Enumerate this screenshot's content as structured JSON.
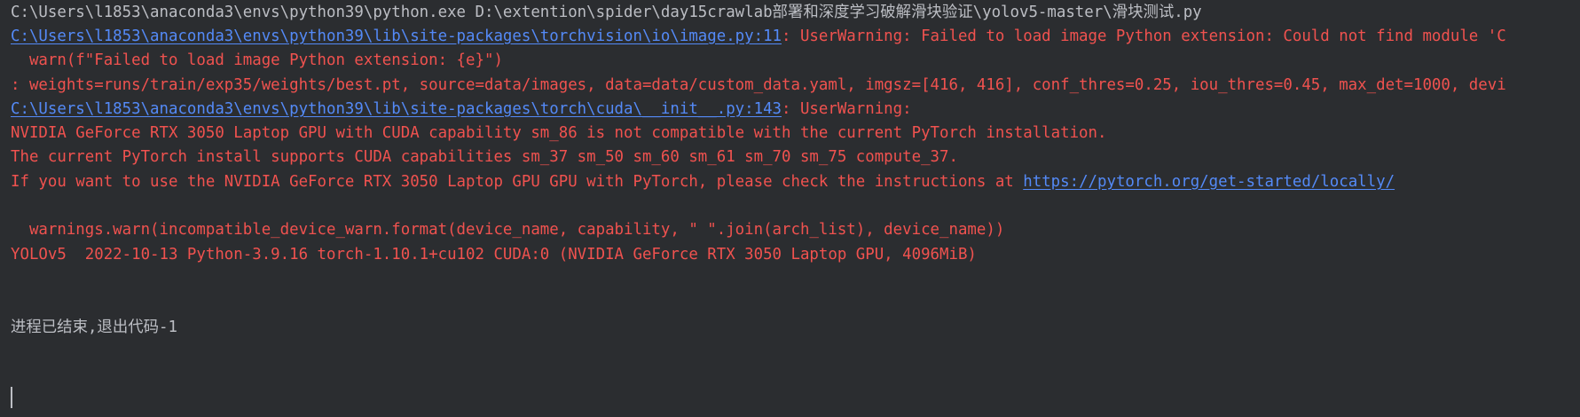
{
  "console": {
    "cmd_line": "C:\\Users\\l1853\\anaconda3\\envs\\python39\\python.exe D:\\extention\\spider\\day15crawlab部署和深度学习破解滑块验证\\yolov5-master\\滑块测试.py",
    "warn1_link": "C:\\Users\\l1853\\anaconda3\\envs\\python39\\lib\\site-packages\\torchvision\\io\\image.py:11",
    "warn1_text": ": UserWarning: Failed to load image Python extension: Could not find module 'C",
    "warn1_code": "  warn(f\"Failed to load image Python extension: {e}\")",
    "params_line": ": weights=runs/train/exp35/weights/best.pt, source=data/images, data=data/custom_data.yaml, imgsz=[416, 416], conf_thres=0.25, iou_thres=0.45, max_det=1000, devi",
    "warn2_link": "C:\\Users\\l1853\\anaconda3\\envs\\python39\\lib\\site-packages\\torch\\cuda\\__init__.py:143",
    "warn2_text": ": UserWarning: ",
    "cuda_line1": "NVIDIA GeForce RTX 3050 Laptop GPU with CUDA capability sm_86 is not compatible with the current PyTorch installation.",
    "cuda_line2": "The current PyTorch install supports CUDA capabilities sm_37 sm_50 sm_60 sm_61 sm_70 sm_75 compute_37.",
    "cuda_line3_text": "If you want to use the NVIDIA GeForce RTX 3050 Laptop GPU GPU with PyTorch, please check the instructions at ",
    "cuda_line3_link": "https://pytorch.org/get-started/locally/",
    "warn2_code": "  warnings.warn(incompatible_device_warn.format(device_name, capability, \" \".join(arch_list), device_name))",
    "yolo_line": "YOLOv5  2022-10-13 Python-3.9.16 torch-1.10.1+cu102 CUDA:0 (NVIDIA GeForce RTX 3050 Laptop GPU, 4096MiB)",
    "exit_line": "进程已结束,退出代码-1"
  },
  "colors": {
    "background": "#2b2d30",
    "plain_text": "#bcbec4",
    "error_text": "#f0524f",
    "link_text": "#548af7"
  }
}
